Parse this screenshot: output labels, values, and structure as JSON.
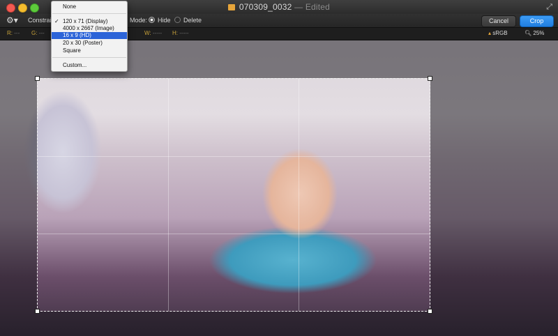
{
  "window": {
    "title": "070309_0032",
    "title_status": "— Edited"
  },
  "toolbar": {
    "constrain_label": "Constrain",
    "mode_label": "Mode:",
    "mode_options": [
      "Hide",
      "Delete"
    ],
    "mode_selected": "Hide",
    "cancel_label": "Cancel",
    "crop_label": "Crop"
  },
  "infobar": {
    "r_label": "R:",
    "r_value": "---",
    "g_label": "G:",
    "g_value": "---",
    "w_label": "W:",
    "w_value": "-----",
    "h_label": "H:",
    "h_value": "-----",
    "color_profile": "sRGB",
    "zoom": "25%"
  },
  "constrain_menu": {
    "items": [
      "None",
      "120 x 71 (Display)",
      "4000 x 2667 (Image)",
      "16 x 9 (HD)",
      "20 x 30 (Poster)",
      "Square",
      "Custom..."
    ],
    "checked": "120 x 71 (Display)",
    "highlighted": "16 x 9 (HD)",
    "check_mark": "✓"
  },
  "icons": [
    "gear-icon",
    "document-icon",
    "fullscreen-icon",
    "color-profile-icon",
    "zoom-icon"
  ],
  "colors": {
    "accent": "#2c7fe0",
    "menu_highlight": "#2c64d8"
  }
}
